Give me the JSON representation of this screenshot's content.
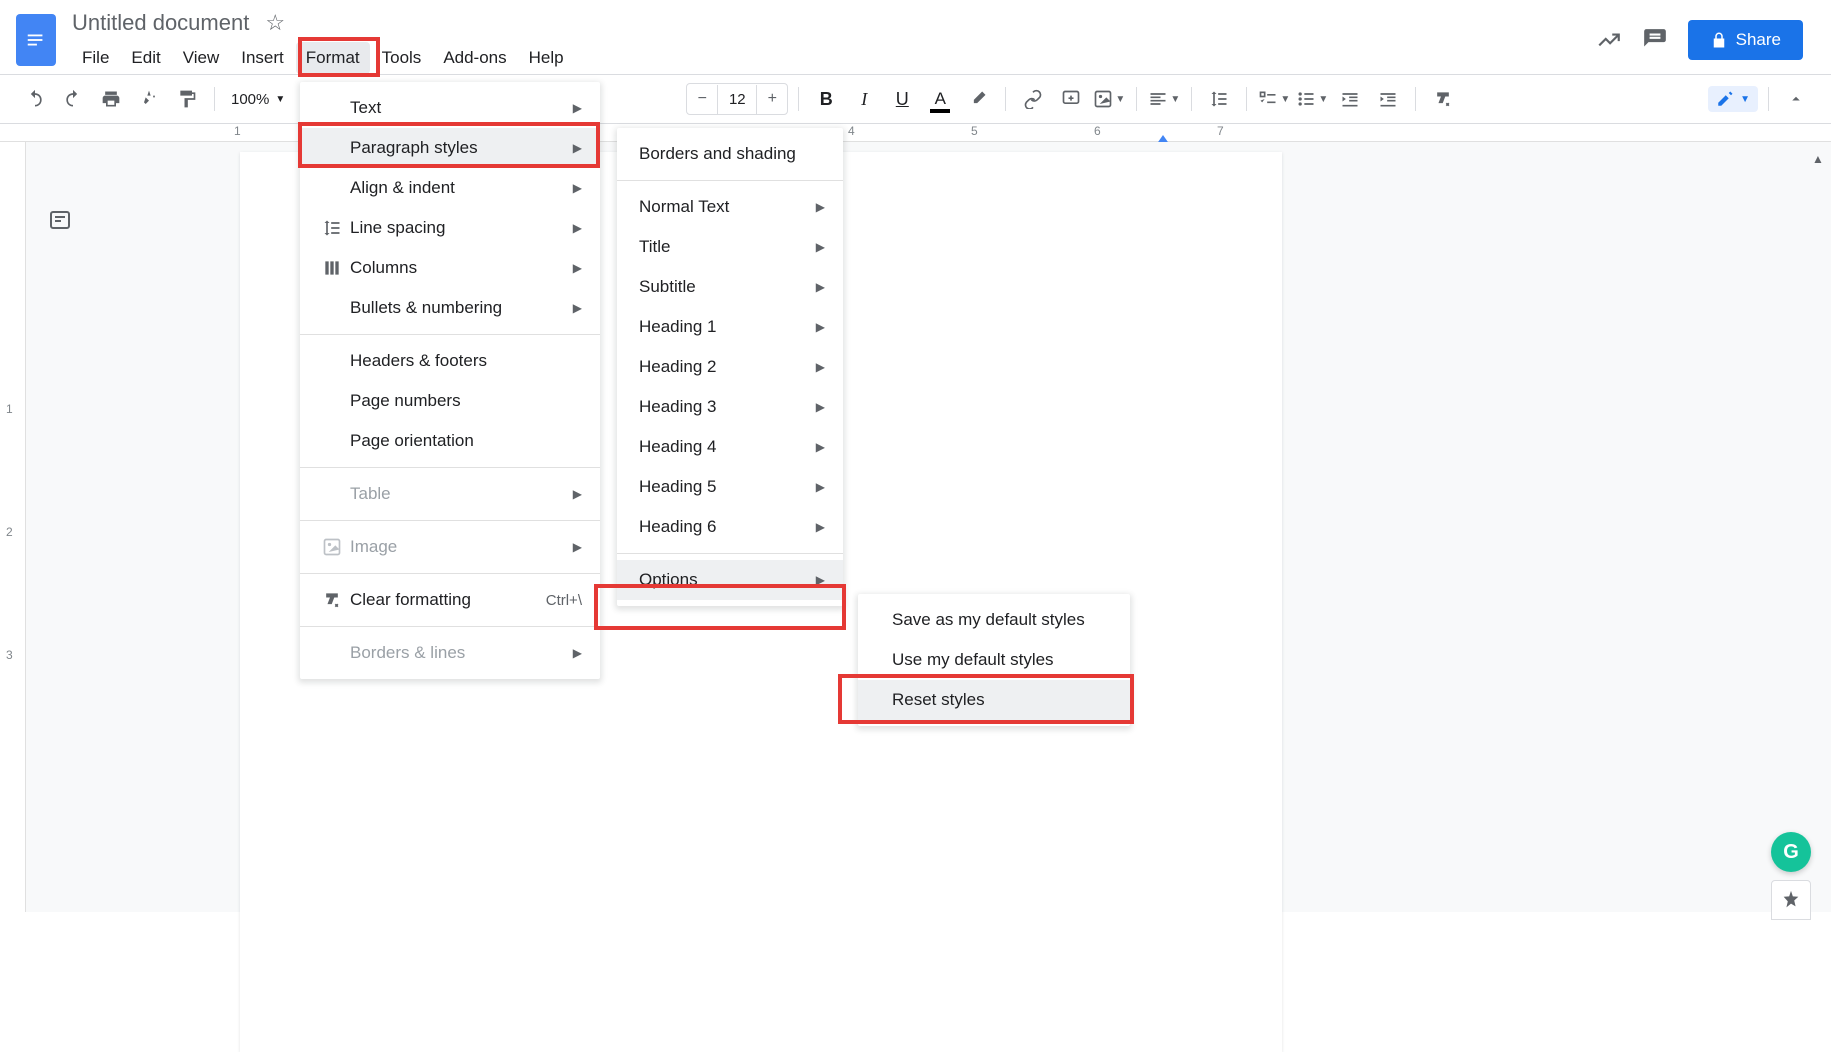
{
  "header": {
    "doc_title": "Untitled document",
    "share_label": "Share"
  },
  "menubar": {
    "items": [
      "File",
      "Edit",
      "View",
      "Insert",
      "Format",
      "Tools",
      "Add-ons",
      "Help"
    ]
  },
  "toolbar": {
    "zoom": "100%",
    "font_size": "12"
  },
  "ruler": {
    "numbers": [
      "1",
      "4",
      "5",
      "6",
      "7"
    ]
  },
  "gutter": {
    "numbers": [
      "1",
      "2",
      "3"
    ]
  },
  "format_menu": {
    "text": "Text",
    "paragraph_styles": "Paragraph styles",
    "align_indent": "Align & indent",
    "line_spacing": "Line spacing",
    "columns": "Columns",
    "bullets_numbering": "Bullets & numbering",
    "headers_footers": "Headers & footers",
    "page_numbers": "Page numbers",
    "page_orientation": "Page orientation",
    "table": "Table",
    "image": "Image",
    "clear_formatting": "Clear formatting",
    "clear_formatting_shortcut": "Ctrl+\\",
    "borders_lines": "Borders & lines"
  },
  "paragraph_submenu": {
    "borders_shading": "Borders and shading",
    "normal_text": "Normal Text",
    "title": "Title",
    "subtitle": "Subtitle",
    "heading1": "Heading 1",
    "heading2": "Heading 2",
    "heading3": "Heading 3",
    "heading4": "Heading 4",
    "heading5": "Heading 5",
    "heading6": "Heading 6",
    "options": "Options"
  },
  "options_submenu": {
    "save_default": "Save as my default styles",
    "use_default": "Use my default styles",
    "reset": "Reset styles"
  },
  "grammarly_letter": "G"
}
